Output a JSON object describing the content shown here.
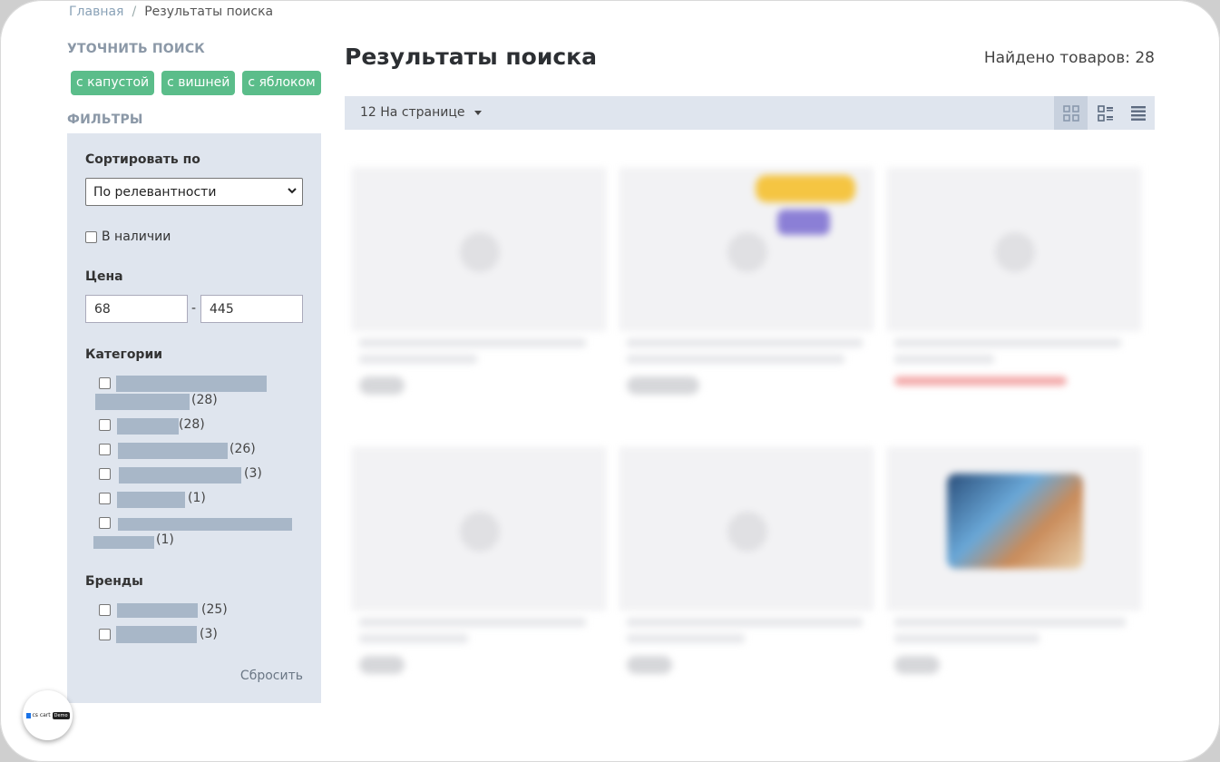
{
  "breadcrumb": {
    "home": "Главная",
    "separator": "/",
    "current": "Результаты поиска"
  },
  "refine": {
    "heading": "УТОЧНИТЬ ПОИСК",
    "tags": [
      "с капустой",
      "с вишней",
      "с яблоком"
    ]
  },
  "filters": {
    "heading": "ФИЛЬТРЫ",
    "sort_label": "Сортировать по",
    "sort_value": "По релевантности",
    "in_stock_label": "В наличии",
    "price_label": "Цена",
    "price_min": "68",
    "price_dash": "-",
    "price_max": "445",
    "categories_label": "Категории",
    "categories": [
      {
        "count": "(28)"
      },
      {
        "count": "(28)"
      },
      {
        "count": "(26)"
      },
      {
        "count": "(3)"
      },
      {
        "count": "(1)"
      },
      {
        "count": "(1)"
      }
    ],
    "brands_label": "Бренды",
    "brands": [
      {
        "count": "(25)"
      },
      {
        "count": "(3)"
      }
    ],
    "reset_label": "Сбросить"
  },
  "main": {
    "title": "Результаты поиска",
    "found": "Найдено товаров: 28",
    "per_page": "12 На странице"
  },
  "widget": {
    "brand": "cs cart",
    "tag": "Demo"
  },
  "colors": {
    "tag_green": "#5bbd8a",
    "panel_bg": "#dfe5ee",
    "bar": "#a8b7c8"
  },
  "icons": [
    "grid-view-icon",
    "list-view-icon",
    "compact-view-icon",
    "chevron-down-icon"
  ]
}
